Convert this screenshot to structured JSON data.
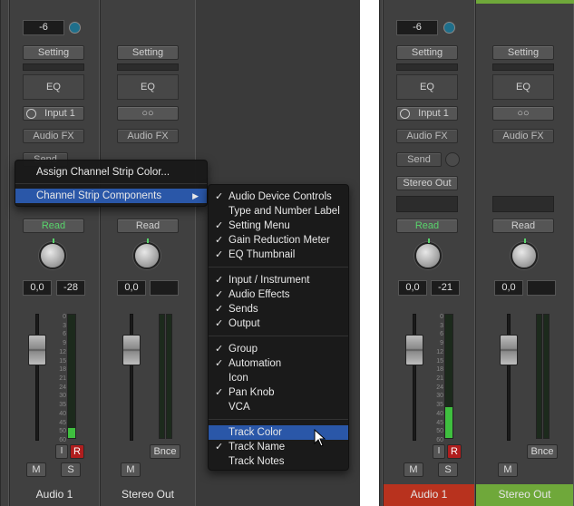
{
  "left": {
    "audio1": {
      "gain": "-6",
      "setting": "Setting",
      "eq": "EQ",
      "input": "Input 1",
      "audio_fx": "Audio FX",
      "send": "Send",
      "read": "Read",
      "pan": "0,0",
      "level": "-28",
      "meter_level": 0.08,
      "btn_i": "I",
      "btn_r": "R",
      "btn_m": "M",
      "btn_s": "S",
      "name": "Audio 1"
    },
    "stereo": {
      "setting": "Setting",
      "eq": "EQ",
      "audio_fx": "Audio FX",
      "read": "Read",
      "pan": "0,0",
      "bnce": "Bnce",
      "btn_m": "M",
      "name": "Stereo Out"
    }
  },
  "scale": [
    "0",
    "3",
    "6",
    "9",
    "12",
    "15",
    "18",
    "21",
    "24",
    "30",
    "35",
    "40",
    "45",
    "50",
    "60"
  ],
  "context_menu": {
    "items": [
      "Assign Channel Strip Color...",
      "Channel Strip Components"
    ]
  },
  "submenu": {
    "items": [
      {
        "label": "Audio Device Controls",
        "checked": true
      },
      {
        "label": "Type and Number Label",
        "checked": false
      },
      {
        "label": "Setting Menu",
        "checked": true
      },
      {
        "label": "Gain Reduction Meter",
        "checked": true
      },
      {
        "label": "EQ Thumbnail",
        "checked": true
      },
      {
        "label": "Input / Instrument",
        "checked": true
      },
      {
        "label": "Audio Effects",
        "checked": true
      },
      {
        "label": "Sends",
        "checked": true
      },
      {
        "label": "Output",
        "checked": true
      },
      {
        "label": "Group",
        "checked": true
      },
      {
        "label": "Automation",
        "checked": true
      },
      {
        "label": "Icon",
        "checked": false
      },
      {
        "label": "Pan Knob",
        "checked": true
      },
      {
        "label": "VCA",
        "checked": false
      },
      {
        "label": "Track Color",
        "checked": false
      },
      {
        "label": "Track Name",
        "checked": true
      },
      {
        "label": "Track Notes",
        "checked": false
      }
    ]
  },
  "right": {
    "audio1": {
      "gain": "-6",
      "setting": "Setting",
      "eq": "EQ",
      "input": "Input 1",
      "audio_fx": "Audio FX",
      "send": "Send",
      "output": "Stereo Out",
      "read": "Read",
      "pan": "0,0",
      "level": "-21",
      "meter_level": 0.25,
      "btn_i": "I",
      "btn_r": "R",
      "btn_m": "M",
      "btn_s": "S",
      "name": "Audio 1",
      "color": "#b8321e"
    },
    "stereo": {
      "setting": "Setting",
      "eq": "EQ",
      "audio_fx": "Audio FX",
      "read": "Read",
      "pan": "0,0",
      "bnce": "Bnce",
      "btn_m": "M",
      "name": "Stereo Out",
      "color": "#6fa83a"
    }
  }
}
